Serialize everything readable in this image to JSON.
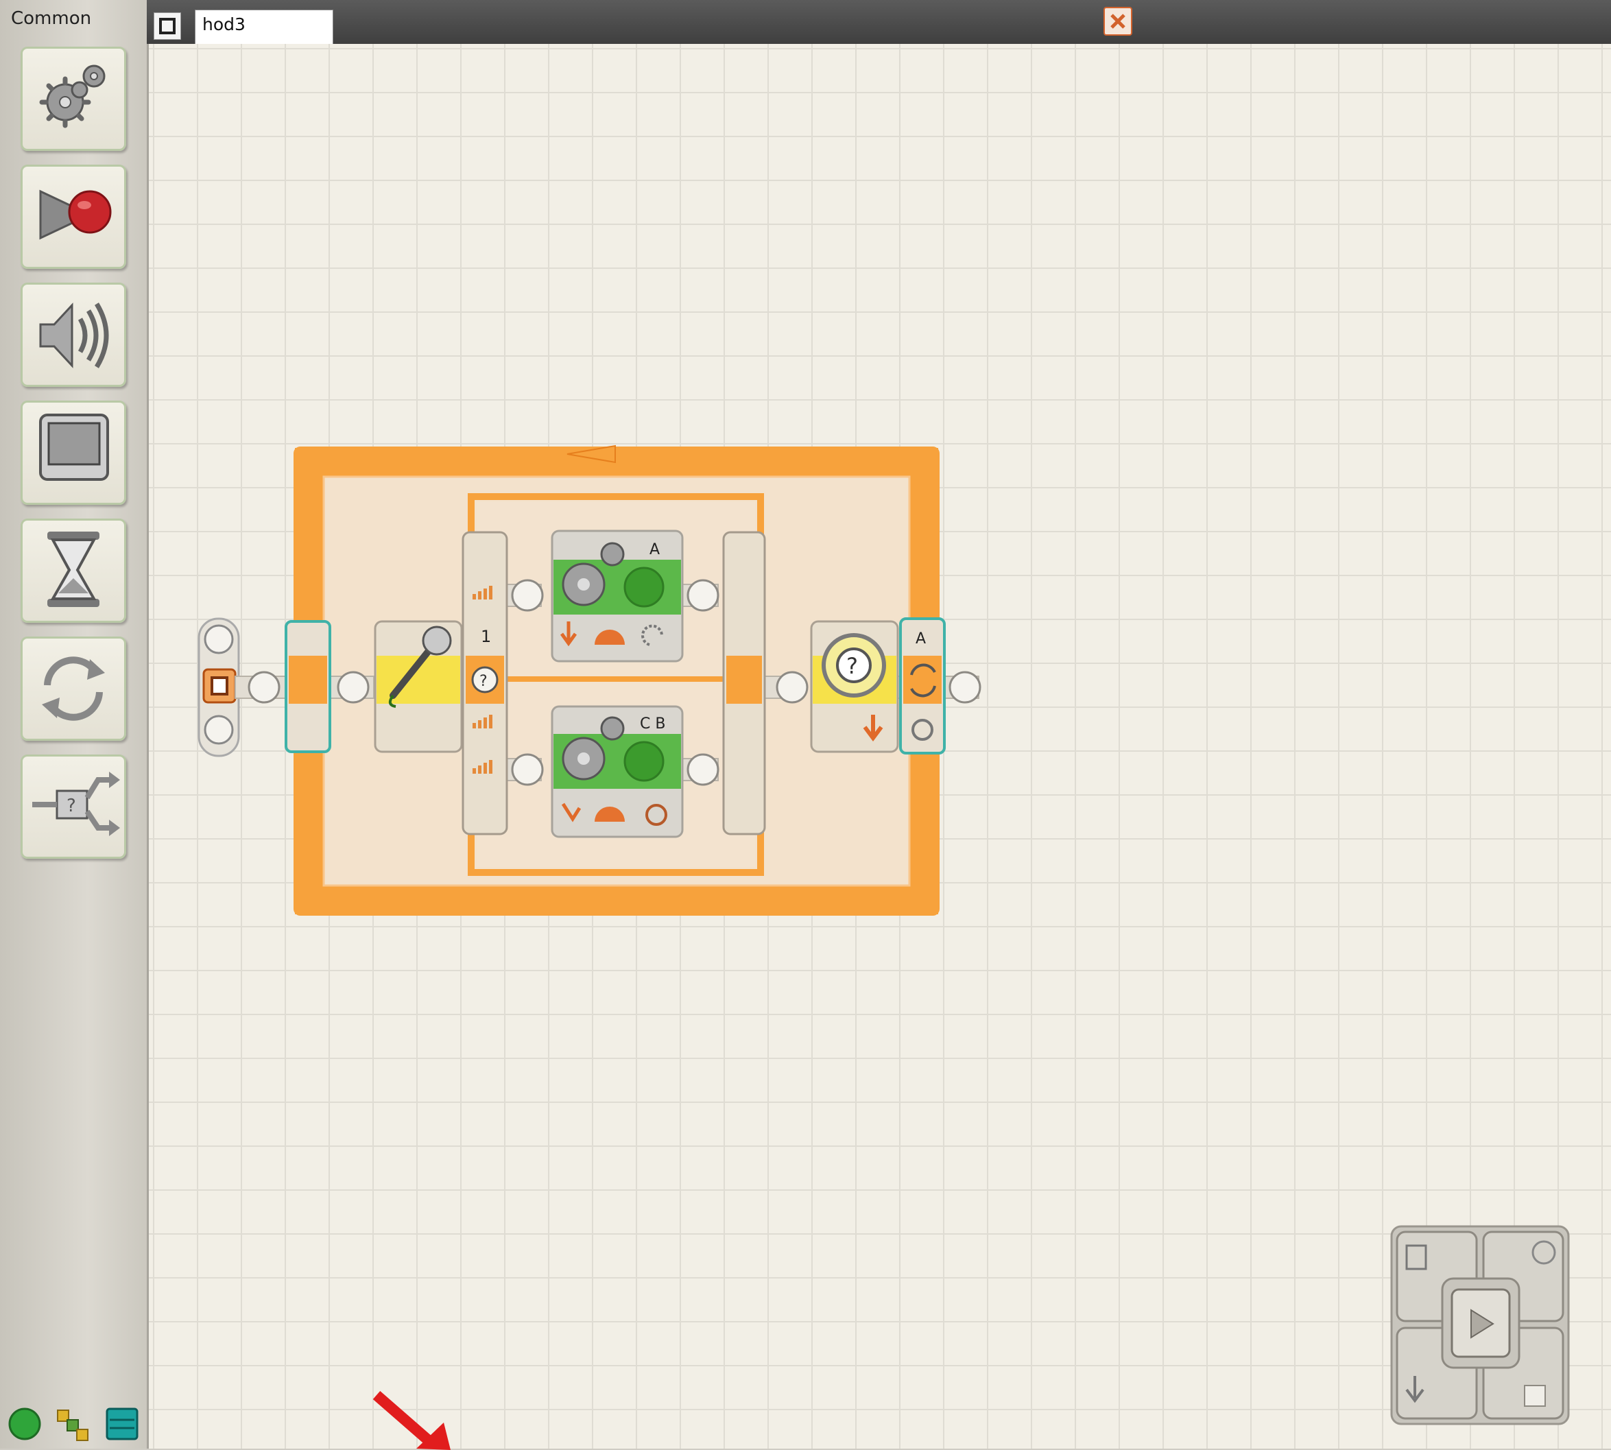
{
  "palette": {
    "title": "Common",
    "items": [
      {
        "icon": "move-gears-icon",
        "name": "Move"
      },
      {
        "icon": "record-play-icon",
        "name": "Record/Play"
      },
      {
        "icon": "sound-speaker-icon",
        "name": "Sound"
      },
      {
        "icon": "display-icon",
        "name": "Display"
      },
      {
        "icon": "hourglass-wait-icon",
        "name": "Wait"
      },
      {
        "icon": "loop-arrows-icon",
        "name": "Loop"
      },
      {
        "icon": "switch-icon",
        "name": "Switch"
      }
    ],
    "bottom_icons": [
      "green-circle-icon",
      "complete-palette-icon",
      "custom-palette-icon"
    ]
  },
  "tab": {
    "name": "hod3"
  },
  "program": {
    "motor_top_ports": "A",
    "motor_bottom_ports": "C B",
    "switch_case_label": "1",
    "loop_port": "A"
  },
  "colors": {
    "loop_orange": "#f7a23c",
    "switch_orange": "#f7a23c",
    "motor_green": "#5cb84a",
    "sensor_yellow": "#f6e14a",
    "close_accent": "#d2622c"
  }
}
